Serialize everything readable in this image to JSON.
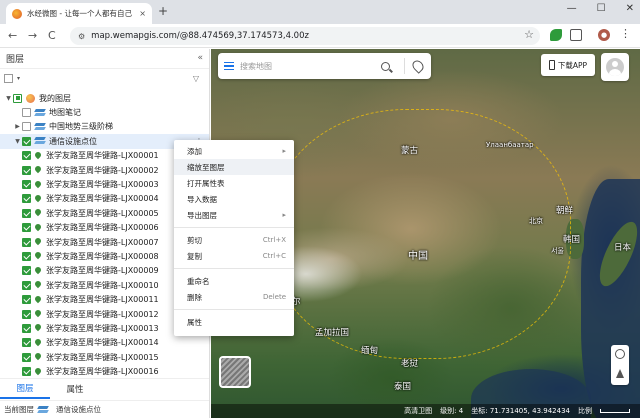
{
  "browser": {
    "tab_title": "水经微图 - 让每一个人都有自己",
    "tab_close": "×",
    "new_tab": "+",
    "window_controls": [
      "—",
      "☐",
      "✕"
    ],
    "nav": {
      "back": "←",
      "forward": "→",
      "reload": "C"
    },
    "url": "map.wemapgis.com/@88.474569,37.174573,4.00z",
    "star": "☆",
    "menu": "⋮"
  },
  "panel": {
    "title": "图层",
    "collapse": "«",
    "filter_icon": "▽",
    "tree": {
      "root": "我的图层",
      "children": [
        "地图笔记",
        "中国地势三级阶梯",
        "通信设施点位"
      ],
      "items": [
        "张学友路至周华键路-LJX00001",
        "张学友路至周华键路-LJX00002",
        "张学友路至周华键路-LJX00003",
        "张学友路至周华键路-LJX00004",
        "张学友路至周华键路-LJX00005",
        "张学友路至周华键路-LJX00006",
        "张学友路至周华键路-LJX00007",
        "张学友路至周华键路-LJX00008",
        "张学友路至周华键路-LJX00009",
        "张学友路至周华键路-LJX00010",
        "张学友路至周华键路-LJX00011",
        "张学友路至周华键路-LJX00012",
        "张学友路至周华键路-LJX00013",
        "张学友路至周华键路-LJX00014",
        "张学友路至周华键路-LJX00015",
        "张学友路至周华键路-LJX00016"
      ]
    },
    "tabs": [
      "图层",
      "属性"
    ],
    "footer": {
      "label": "当前图层",
      "value": "通信设施点位"
    }
  },
  "context_menu": {
    "items": [
      {
        "label": "添加",
        "arrow": "▸"
      },
      {
        "label": "缩放至图层"
      },
      {
        "label": "打开属性表"
      },
      {
        "label": "导入数据"
      },
      {
        "label": "导出图层",
        "arrow": "▸"
      },
      {
        "label": "剪切",
        "shortcut": "Ctrl+X"
      },
      {
        "label": "复制",
        "shortcut": "Ctrl+C"
      },
      {
        "label": "重命名"
      },
      {
        "label": "删除",
        "shortcut": "Delete"
      },
      {
        "label": "属性"
      }
    ]
  },
  "map": {
    "search_placeholder": "搜索地图",
    "download_label": "下载APP",
    "labels": {
      "mongolia": "蒙古",
      "china": "中国",
      "north_korea": "朝鲜",
      "south_korea": "韩国",
      "japan": "日本",
      "nepal": "尼泊尔",
      "bangladesh": "孟加拉国",
      "myanmar": "缅甸",
      "laos": "老挝",
      "thailand": "泰国",
      "ulaanbaatar": "Улаанбаатар",
      "beijing": "北京",
      "seoul": "서울"
    },
    "status": {
      "source": "高清卫图",
      "zoom_label": "级别:",
      "zoom": "4",
      "coord_label": "坐标:",
      "coords": "71.731405, 43.942434",
      "scale_label": "比例"
    }
  }
}
